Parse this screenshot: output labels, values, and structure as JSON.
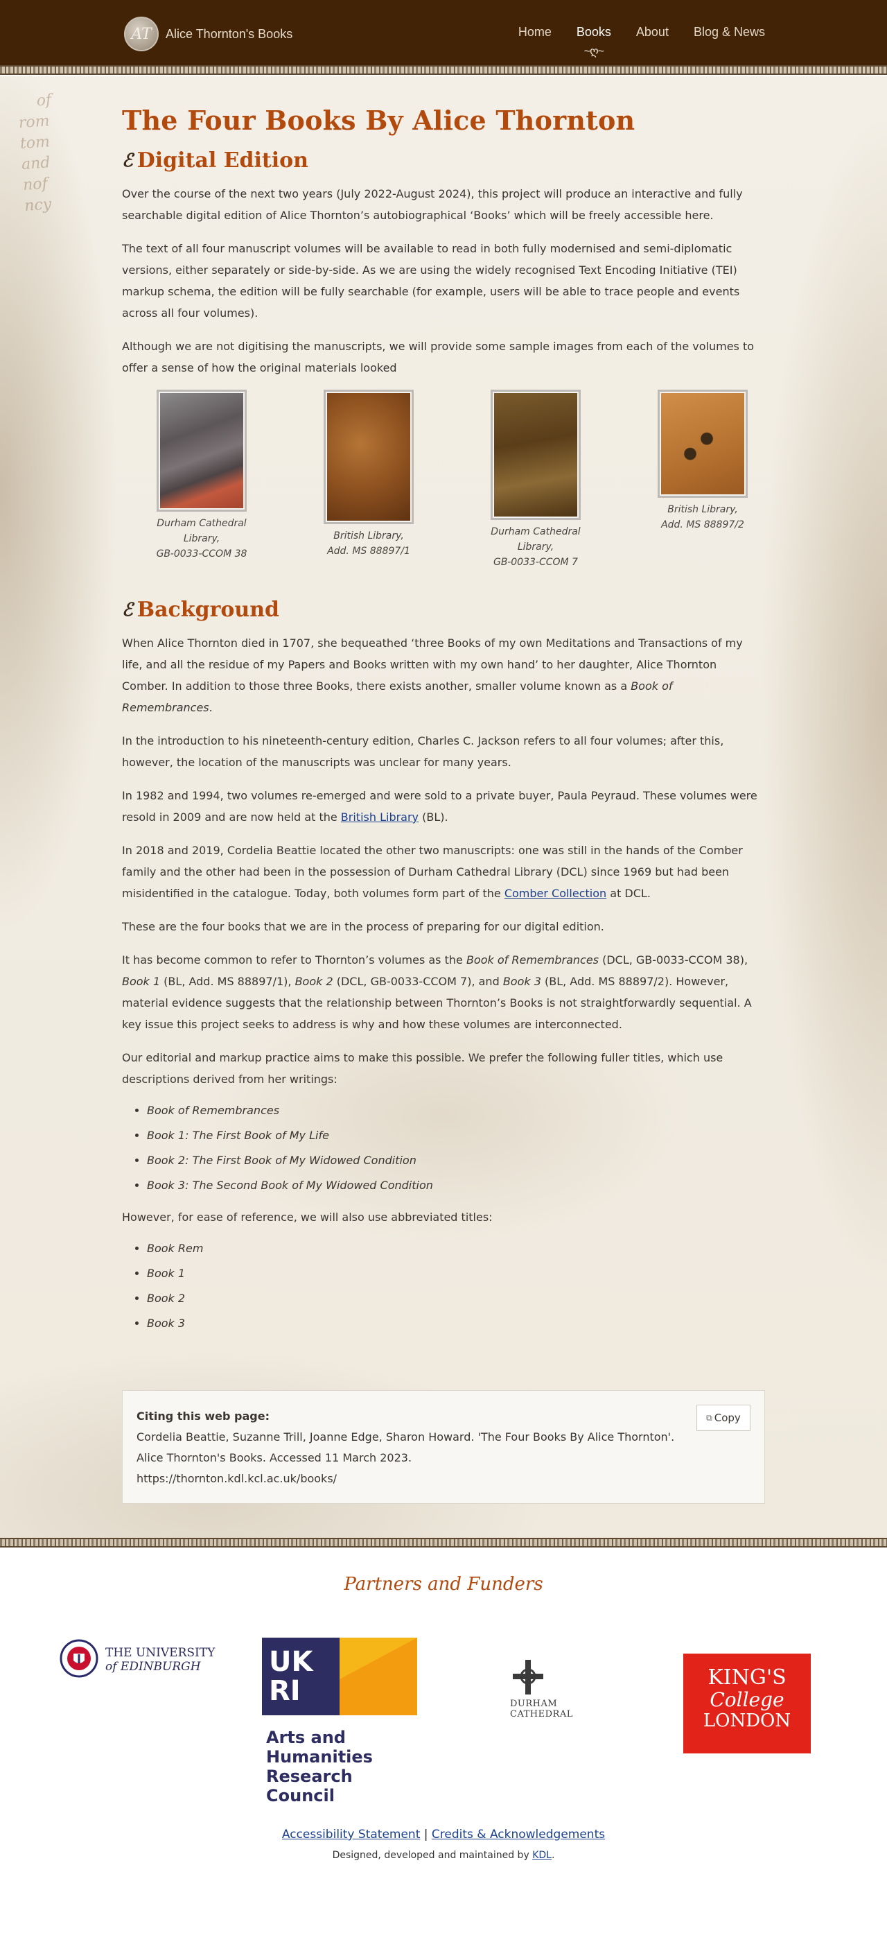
{
  "header": {
    "logo_monogram": "AT",
    "site_name": "Alice Thornton's Books",
    "nav": [
      {
        "label": "Home"
      },
      {
        "label": "Books",
        "active": true
      },
      {
        "label": "About"
      },
      {
        "label": "Blog & News"
      }
    ],
    "active_flourish": "~ღ~"
  },
  "main": {
    "title": "The Four Books By Alice Thornton",
    "digital_edition": {
      "heading": "Digital Edition",
      "p1": "Over the course of the next two years (July 2022-August 2024), this project will produce an interactive and fully searchable digital edition of Alice Thornton’s autobiographical ‘Books’ which will be freely accessible here.",
      "p2": "The text of all four manuscript volumes will be available to read in both fully modernised and semi-diplomatic versions, either separately or side-by-side. As we are using the widely recognised Text Encoding Initiative (TEI) markup schema, the edition will be fully searchable (for example, users will be able to trace people and events across all four volumes).",
      "p3": "Although we are not digitising the manuscripts, we will provide some sample images from each of the volumes to offer a sense of how the original materials looked"
    },
    "gallery": [
      {
        "caption_l1": "Durham Cathedral",
        "caption_l2": "Library,",
        "caption_l3": "GB-0033-CCOM 38"
      },
      {
        "caption_l1": "British Library,",
        "caption_l2": "Add. MS 88897/1"
      },
      {
        "caption_l1": "Durham Cathedral",
        "caption_l2": "Library,",
        "caption_l3": "GB-0033-CCOM 7"
      },
      {
        "caption_l1": "British Library,",
        "caption_l2": "Add. MS 88897/2"
      }
    ],
    "background": {
      "heading": "Background",
      "p1_a": "When Alice Thornton died in 1707, she bequeathed ‘three Books of my own Meditations and Transactions of my life, and all the residue of my Papers and Books written with my own hand’ to her daughter, Alice Thornton Comber. In addition to those three Books, there exists another, smaller volume known as a ",
      "p1_em": "Book of Remembrances",
      "p1_b": ".",
      "p2": "In the introduction to his nineteenth-century edition, Charles C. Jackson refers to all four volumes; after this, however, the location of the manuscripts was unclear for many years.",
      "p3_a": "In 1982 and 1994, two volumes re-emerged and were sold to a private buyer, Paula Peyraud. These volumes were resold in 2009 and are now held at the ",
      "p3_link": "British Library",
      "p3_b": " (BL).",
      "p4_a": "In 2018 and 2019, Cordelia Beattie located the other two manuscripts: one was still in the hands of the Comber family and the other had been in the possession of Durham Cathedral Library (DCL) since 1969 but had been misidentified in the catalogue. Today, both volumes form part of the ",
      "p4_link": "Comber Collection",
      "p4_b": " at DCL.",
      "p5": "These are the four books that we are in the process of preparing for our digital edition.",
      "p6_a": "It has become common to refer to Thornton’s volumes as the ",
      "p6_em1": "Book of Remembrances",
      "p6_b": " (DCL, GB-0033-CCOM 38), ",
      "p6_em2": "Book 1",
      "p6_c": " (BL, Add. MS 88897/1), ",
      "p6_em3": "Book 2",
      "p6_d": " (DCL, GB-0033-CCOM 7), and ",
      "p6_em4": "Book 3",
      "p6_e": " (BL, Add. MS 88897/2). However, material evidence suggests that the relationship between Thornton’s Books is not straightforwardly sequential. A key issue this project seeks to address is why and how these volumes are interconnected.",
      "p7": "Our editorial and markup practice aims to make this possible. We prefer the following fuller titles, which use descriptions derived from her writings:",
      "full_titles": [
        "Book of Remembrances",
        "Book 1: The First Book of My Life",
        "Book 2: The First Book of My Widowed Condition",
        "Book 3: The Second Book of My Widowed Condition"
      ],
      "p8": "However, for ease of reference, we will also use abbreviated titles:",
      "short_titles": [
        "Book Rem",
        "Book 1",
        "Book 2",
        "Book 3"
      ]
    },
    "citation": {
      "heading": "Citing this web page:",
      "line1": "Cordelia Beattie, Suzanne Trill, Joanne Edge, Sharon Howard. 'The Four Books By Alice Thornton'.",
      "line2": "Alice Thornton's Books. Accessed 11 March 2023.",
      "line3": "https://thornton.kdl.kcl.ac.uk/books/",
      "copy_label": "Copy"
    }
  },
  "footer": {
    "partners_title": "Partners and Funders",
    "edinburgh_l1": "THE UNIVERSITY",
    "edinburgh_l2": "of EDINBURGH",
    "ukri_tag": "UKRI",
    "ahrc_l1": "Arts and",
    "ahrc_l2": "Humanities",
    "ahrc_l3": "Research Council",
    "durham_l1": "DURHAM",
    "durham_l2": "CATHEDRAL",
    "kings_l1": "KING'S",
    "kings_l2": "College",
    "kings_l3": "LONDON",
    "link_accessibility": "Accessibility Statement",
    "link_separator": "|",
    "link_credits": "Credits & Acknowledgements",
    "credit_prefix": "Designed, developed and maintained by ",
    "credit_link": "KDL",
    "credit_suffix": "."
  },
  "colors": {
    "header_bg": "#432305",
    "heading_orange": "#b24a0d",
    "link_blue": "#1a3f8f",
    "kings_red": "#e2231a",
    "ukri_navy": "#2e2d62",
    "ukri_orange": "#f39c10"
  }
}
